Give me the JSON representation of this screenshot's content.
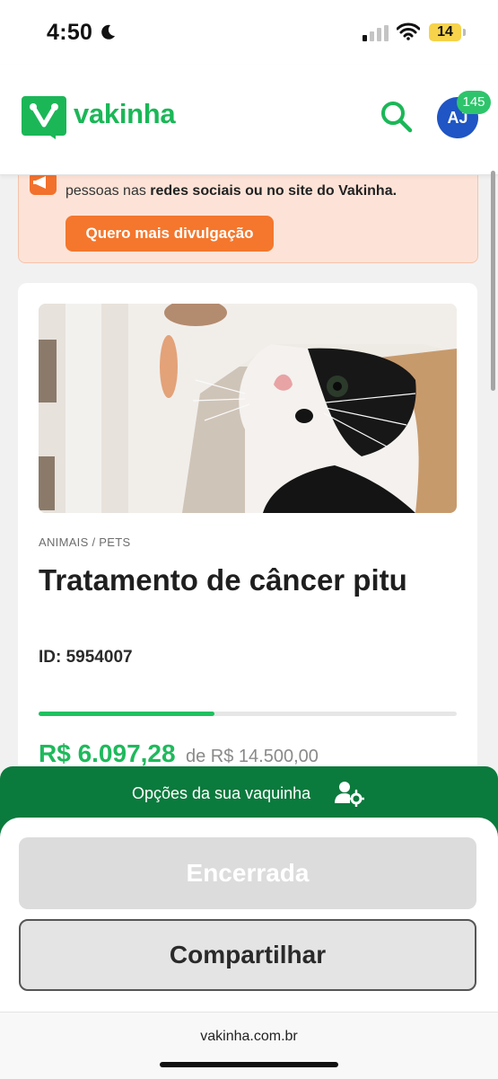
{
  "status_bar": {
    "time": "4:50",
    "battery": "14"
  },
  "header": {
    "logo_text": "vakinha",
    "avatar_initials": "AJ",
    "notification_count": "145"
  },
  "alert": {
    "text_prefix": "pessoas nas ",
    "text_bold": "redes sociais ou no site do Vakinha.",
    "button_label": "Quero mais divulgação"
  },
  "campaign": {
    "category": "ANIMAIS / PETS",
    "title": "Tratamento de câncer pitu",
    "id_label": "ID: 5954007",
    "progress_fraction": 0.42,
    "raised": "R$ 6.097,28",
    "goal": "de R$ 14.500,00"
  },
  "options": {
    "title": "Opções da sua vaquinha",
    "closed_label": "Encerrada",
    "share_label": "Compartilhar"
  },
  "browser": {
    "url": "vakinha.com.br"
  },
  "colors": {
    "brand_green": "#1bb757",
    "dark_green": "#0b7a3d",
    "orange": "#f4772d",
    "avatar_blue": "#1f55c4"
  }
}
